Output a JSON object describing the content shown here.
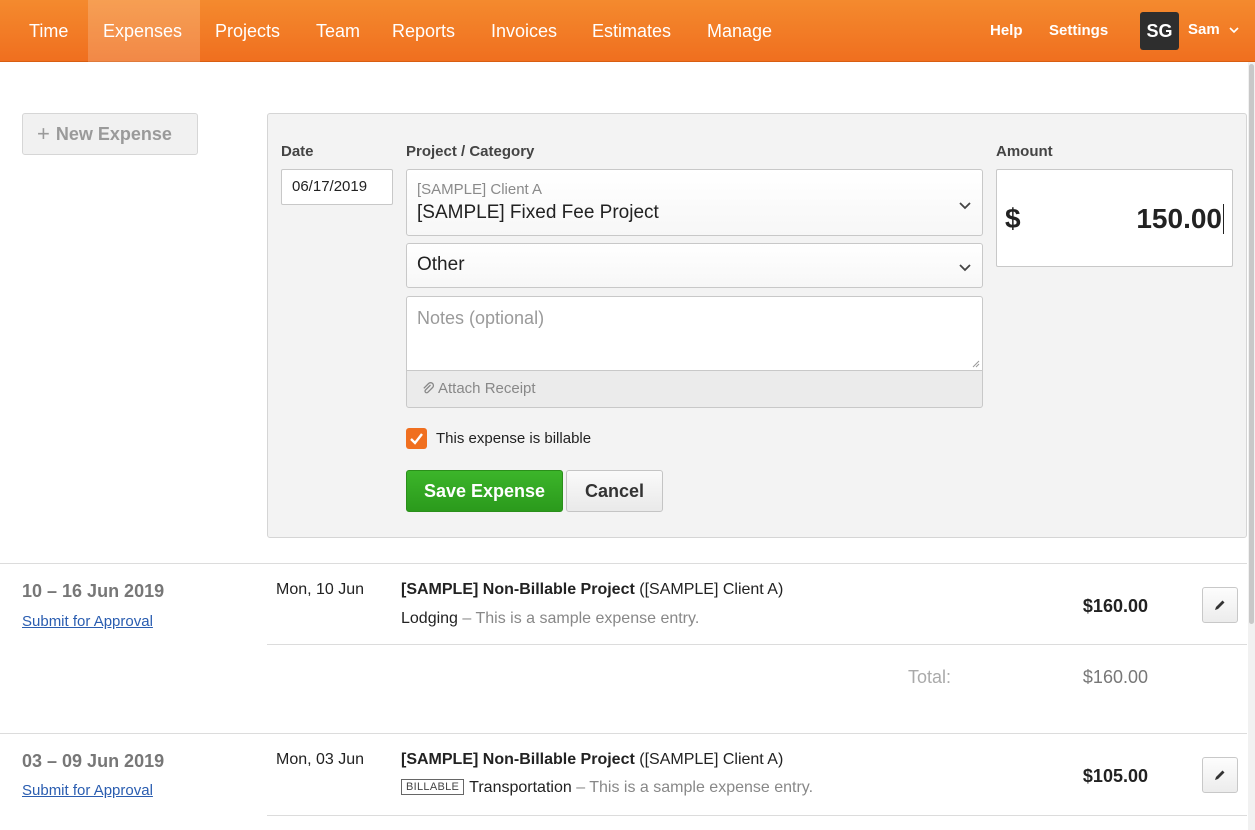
{
  "nav": {
    "items": [
      {
        "label": "Time"
      },
      {
        "label": "Expenses"
      },
      {
        "label": "Projects"
      },
      {
        "label": "Team"
      },
      {
        "label": "Reports"
      },
      {
        "label": "Invoices"
      },
      {
        "label": "Estimates"
      },
      {
        "label": "Manage"
      }
    ],
    "active": "Expenses",
    "help": "Help",
    "settings": "Settings",
    "avatar_initials": "SG",
    "user_name": "Sam",
    "accent_color": "#f06f1f"
  },
  "new_expense": {
    "plus": "+",
    "label": "New Expense"
  },
  "form": {
    "date_label": "Date",
    "date_value": "06/17/2019",
    "project_label": "Project / Category",
    "project_client": "[SAMPLE] Client A",
    "project_name": "[SAMPLE] Fixed Fee Project",
    "category_value": "Other",
    "notes_placeholder": "Notes (optional)",
    "attach_label": "Attach Receipt",
    "amount_label": "Amount",
    "currency": "$",
    "amount_value": "150.00",
    "billable_checked": true,
    "billable_label": "This expense is billable",
    "save_label": "Save Expense",
    "cancel_label": "Cancel",
    "save_color": "#2b9a1c"
  },
  "weeks": [
    {
      "range": "10 – 16 Jun 2019",
      "submit": "Submit for Approval",
      "entries": [
        {
          "day": "Mon, 10 Jun",
          "project": "[SAMPLE] Non-Billable Project",
          "client": "([SAMPLE] Client A)",
          "billable_badge": "",
          "category": "Lodging",
          "description": "– This is a sample expense entry.",
          "amount": "$160.00"
        }
      ],
      "total_label": "Total:",
      "total": "$160.00"
    },
    {
      "range": "03 – 09 Jun 2019",
      "submit": "Submit for Approval",
      "entries": [
        {
          "day": "Mon, 03 Jun",
          "project": "[SAMPLE] Non-Billable Project",
          "client": "([SAMPLE] Client A)",
          "billable_badge": "BILLABLE",
          "category": "Transportation",
          "description": "– This is a sample expense entry.",
          "amount": "$105.00"
        }
      ]
    }
  ]
}
